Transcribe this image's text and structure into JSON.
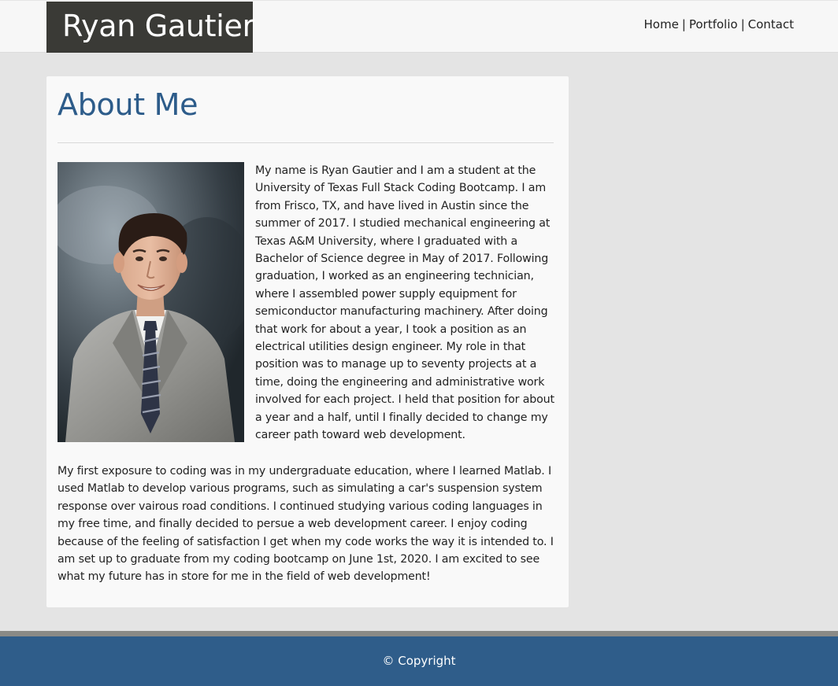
{
  "header": {
    "brand": "Ryan Gautier",
    "nav": [
      "Home",
      "Portfolio",
      "Contact"
    ],
    "separator": "|"
  },
  "about": {
    "title": "About Me",
    "photo_alt": "Portrait of Ryan Gautier in a gray suit and striped tie",
    "paragraph1": "My name is Ryan Gautier and I am a student at the University of Texas Full Stack Coding Bootcamp. I am from Frisco, TX, and have lived in Austin since the summer of 2017. I studied mechanical engineering at Texas A&M University, where I graduated with a Bachelor of Science degree in May of 2017. Following graduation, I worked as an engineering technician, where I assembled power supply equipment for semiconductor manufacturing machinery. After doing that work for about a year, I took a position as an electrical utilities design engineer. My role in that position was to manage up to seventy projects at a time, doing the engineering and administrative work involved for each project. I held that position for about a year and a half, until I finally decided to change my career path toward web development.",
    "paragraph2": "My first exposure to coding was in my undergraduate education, where I learned Matlab. I used Matlab to develop various programs, such as simulating a car's suspension system response over vairous road conditions. I continued studying various coding languages in my free time, and finally decided to persue a web development career. I enjoy coding because of the feeling of satisfaction I get when my code works the way it is intended to. I am set up to graduate from my coding bootcamp on June 1st, 2020. I am excited to see what my future has in store for me in the field of web development!"
  },
  "footer": {
    "text": "© Copyright"
  },
  "colors": {
    "brand_bg": "#3a3a36",
    "accent_blue": "#2d5c8a",
    "footer_bg": "#2f5d8a",
    "page_bg": "#e4e4e4"
  }
}
